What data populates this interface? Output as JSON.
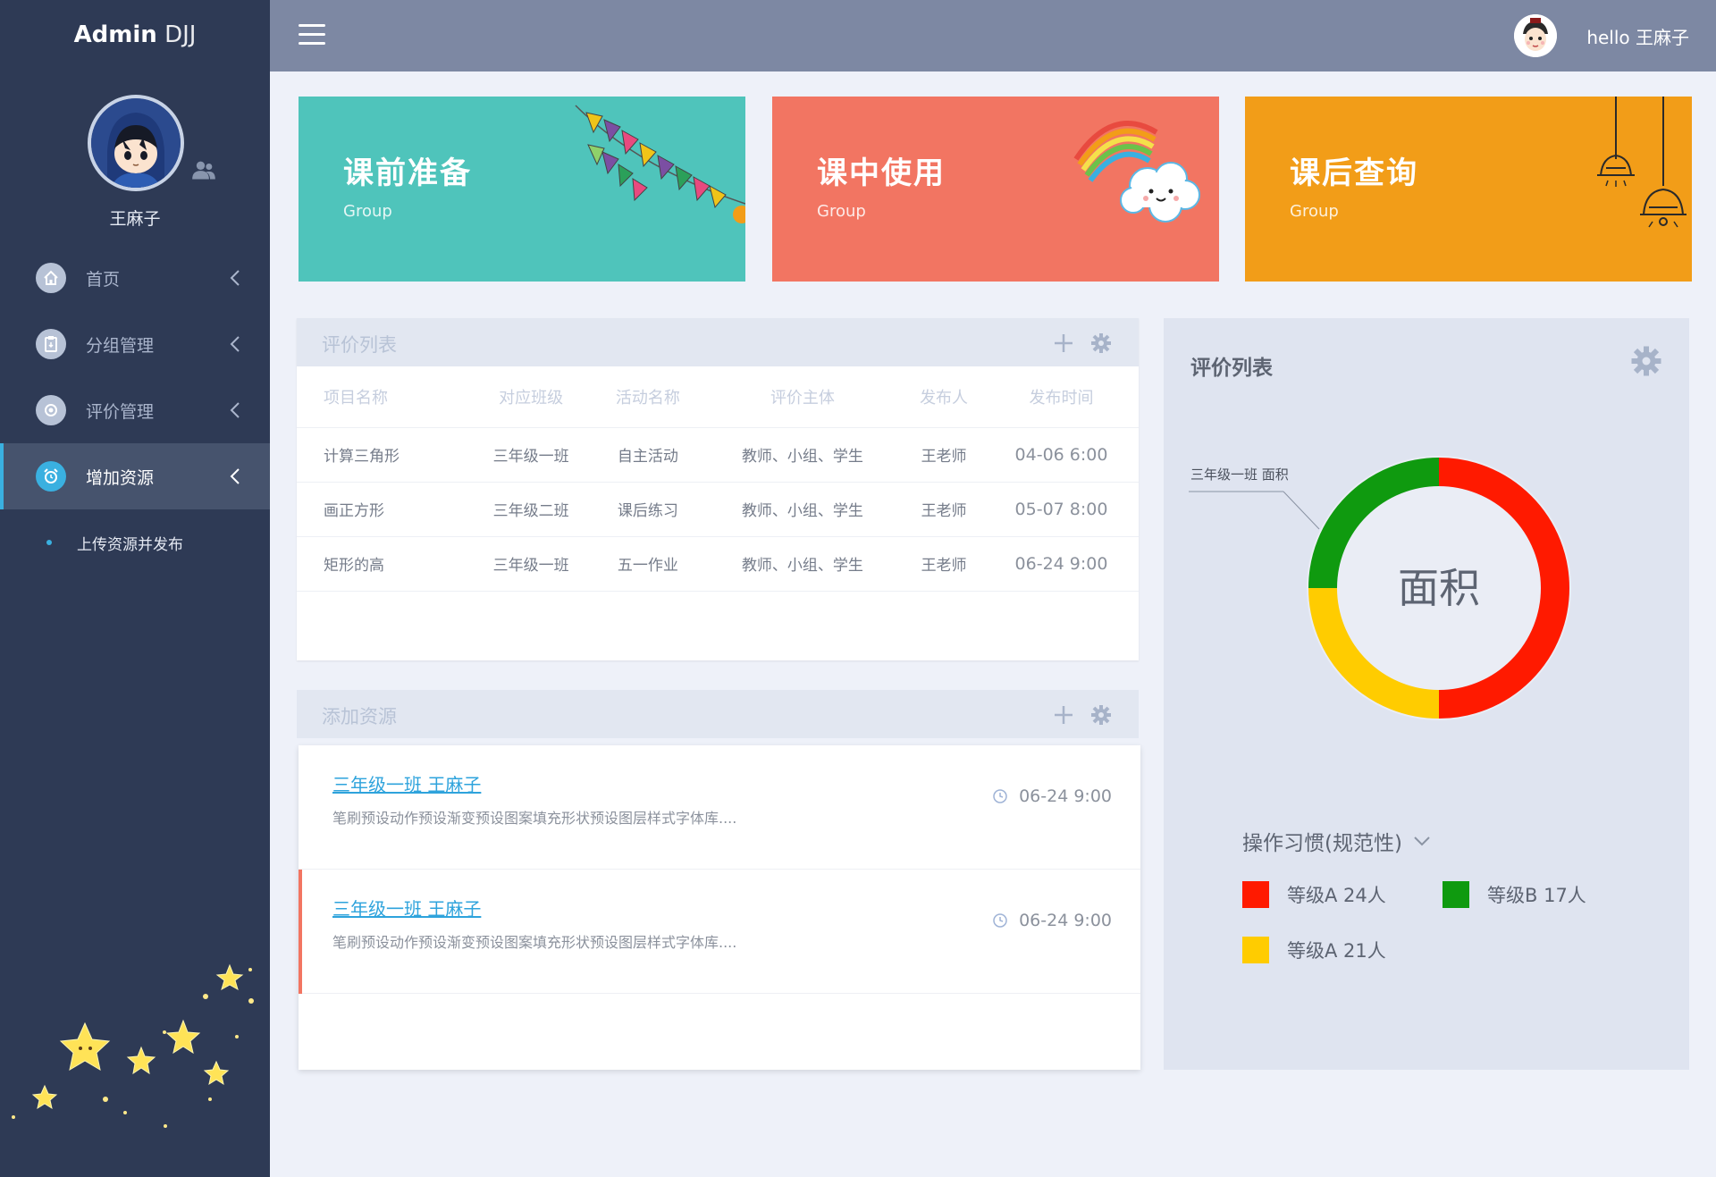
{
  "sidebar": {
    "logo_bold": "Admin",
    "logo_light": "DJJ",
    "username": "王麻子",
    "items": [
      {
        "label": "首页",
        "icon": "home-icon"
      },
      {
        "label": "分组管理",
        "icon": "clipboard-icon"
      },
      {
        "label": "评价管理",
        "icon": "settings-icon"
      },
      {
        "label": "增加资源",
        "icon": "alarm-clock-icon"
      }
    ],
    "active_index": 3,
    "sub_items": [
      {
        "label": "上传资源并发布"
      }
    ]
  },
  "header": {
    "greeting": "hello 王麻子"
  },
  "cards": [
    {
      "title": "课前准备",
      "subtitle": "Group",
      "color": "#4fc4bb"
    },
    {
      "title": "课中使用",
      "subtitle": "Group",
      "color": "#f27562"
    },
    {
      "title": "课后查询",
      "subtitle": "Group",
      "color": "#f29d18"
    }
  ],
  "eval_panel": {
    "title": "评价列表",
    "columns": [
      "项目名称",
      "对应班级",
      "活动名称",
      "评价主体",
      "发布人",
      "发布时间"
    ],
    "rows": [
      [
        "计算三角形",
        "三年级一班",
        "自主活动",
        "教师、小组、学生",
        "王老师",
        "04-06 6:00"
      ],
      [
        "画正方形",
        "三年级二班",
        "课后练习",
        "教师、小组、学生",
        "王老师",
        "05-07 8:00"
      ],
      [
        "矩形的高",
        "三年级一班",
        "五一作业",
        "教师、小组、学生",
        "王老师",
        "06-24 9:00"
      ]
    ]
  },
  "resource_panel": {
    "title": "添加资源",
    "items": [
      {
        "title": "三年级一班   王麻子",
        "desc": "笔刷预设动作预设渐变预设图案填充形状预设图层样式字体库....",
        "time": "06-24 9:00"
      },
      {
        "title": "三年级一班   王麻子",
        "desc": "笔刷预设动作预设渐变预设图案填充形状预设图层样式字体库....",
        "time": "06-24 9:00"
      }
    ],
    "active_index": 1
  },
  "chart_panel": {
    "title": "评价列表",
    "callout": "三年级一班  面积",
    "center_label": "面积",
    "dropdown_label": "操作习惯(规范性)",
    "legend": [
      {
        "label": "等级A 24人",
        "color": "#ff1a00"
      },
      {
        "label": "等级B 17人",
        "color": "#0f9a0f"
      },
      {
        "label": "等级A 21人",
        "color": "#ffcc00"
      }
    ]
  },
  "chart_data": {
    "type": "pie",
    "title": "",
    "center_label": "面积",
    "slices": [
      {
        "label": "等级A",
        "value": 0.5,
        "color": "#ff1a00"
      },
      {
        "label": "等级A",
        "value": 0.25,
        "color": "#ffcc00"
      },
      {
        "label": "等级B",
        "value": 0.25,
        "color": "#0f9a0f"
      }
    ]
  }
}
